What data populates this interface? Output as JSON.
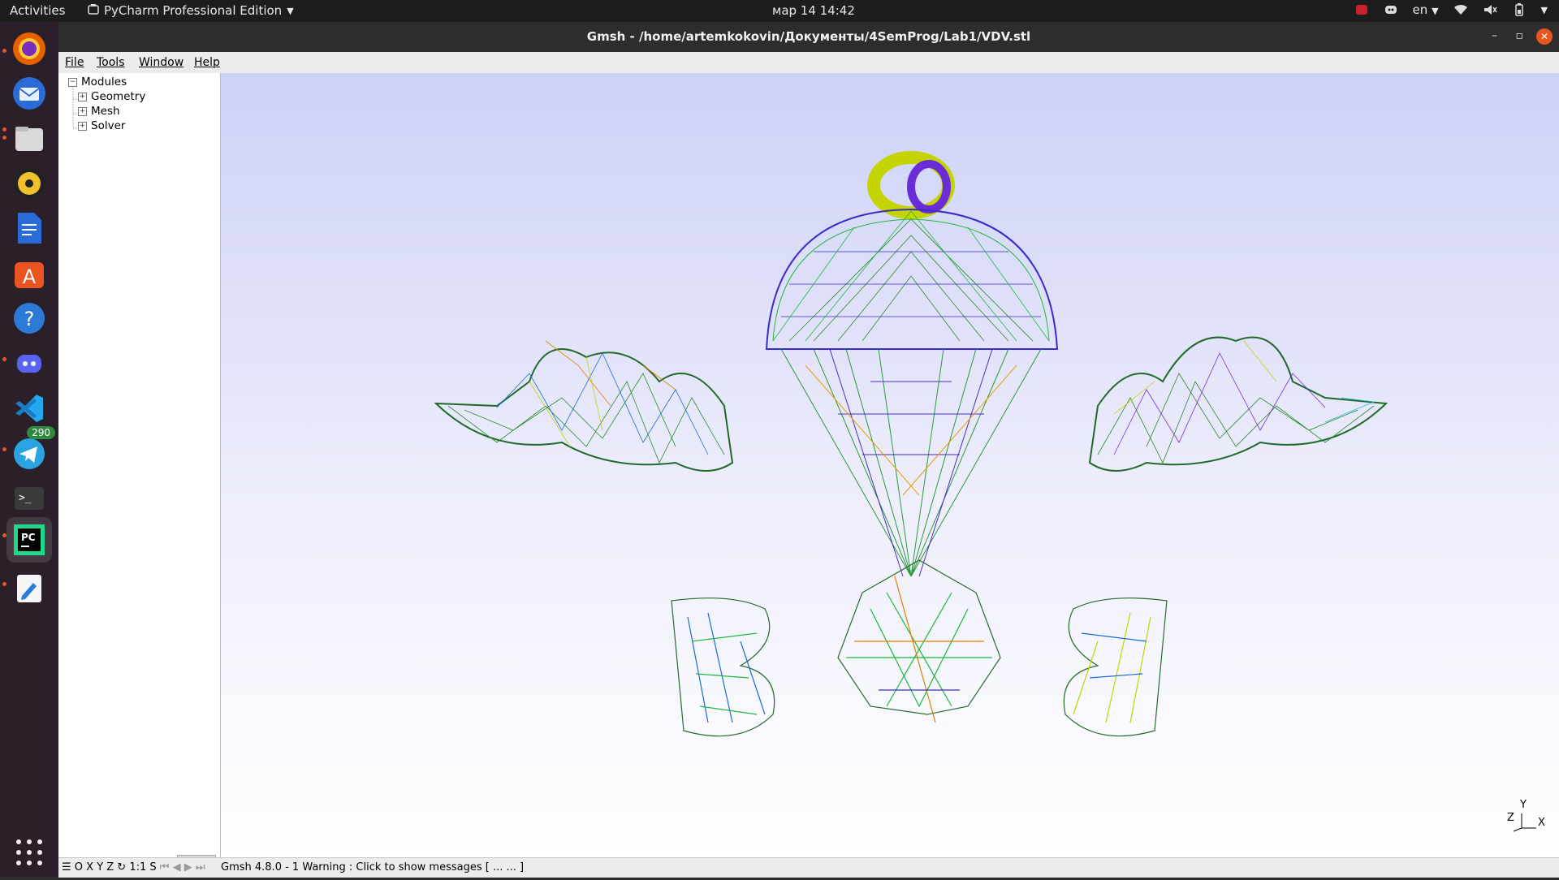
{
  "topbar": {
    "activities": "Activities",
    "app_name": "PyCharm Professional Edition",
    "clock": "мар 14  14:42",
    "lang": "en"
  },
  "dock": {
    "items": [
      {
        "name": "firefox",
        "color": "#e66000"
      },
      {
        "name": "thunderbird",
        "color": "#2a6bd6"
      },
      {
        "name": "files",
        "color": "#9e9e9e"
      },
      {
        "name": "rhythmbox",
        "color": "#f2c12e"
      },
      {
        "name": "libreoffice-writer",
        "color": "#2a6bd6"
      },
      {
        "name": "app-center",
        "color": "#e95420"
      },
      {
        "name": "help",
        "color": "#2b7bd6"
      },
      {
        "name": "discord",
        "color": "#5865f2"
      },
      {
        "name": "vscode",
        "color": "#23a9f2"
      },
      {
        "name": "telegram",
        "color": "#2aa3e0"
      },
      {
        "name": "terminal",
        "color": "#3a3a3a"
      },
      {
        "name": "pycharm",
        "color": "#21d789"
      },
      {
        "name": "text-editor",
        "color": "#2b7bd6"
      }
    ],
    "telegram_badge": "290"
  },
  "window": {
    "title": "Gmsh - /home/artemkokovin/Документы/4SemProg/Lab1/VDV.stl"
  },
  "menubar": {
    "items": [
      "File",
      "Tools",
      "Window",
      "Help"
    ]
  },
  "tree": {
    "root": "Modules",
    "children": [
      "Geometry",
      "Mesh",
      "Solver"
    ]
  },
  "statusbar": {
    "controls": "O X Y Z ↻ 1:1 S",
    "message": "Gmsh 4.8.0  -  1 Warning : Click to show messages [ ...  ... ]"
  },
  "axes": {
    "y": "Y",
    "z": "Z",
    "x": "X"
  }
}
